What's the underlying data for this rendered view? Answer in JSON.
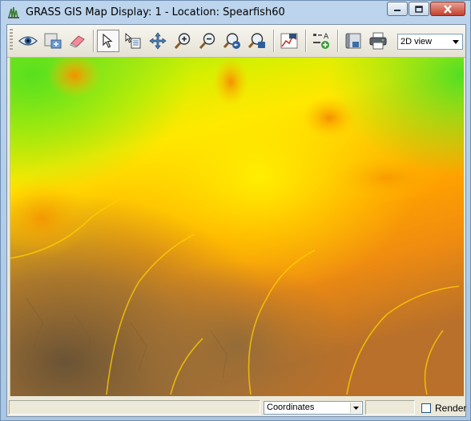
{
  "window": {
    "title": "GRASS GIS Map Display: 1 - Location: Spearfish60",
    "controls": {
      "minimize": "minimize",
      "maximize": "maximize",
      "close": "close"
    }
  },
  "toolbar": {
    "tools": [
      {
        "id": "display-map",
        "icon": "eye-icon",
        "tooltip": ""
      },
      {
        "id": "render-map",
        "icon": "render-map-icon",
        "tooltip": ""
      },
      {
        "id": "erase",
        "icon": "eraser-icon",
        "tooltip": ""
      },
      {
        "id": "pointer",
        "icon": "pointer-icon",
        "active": true
      },
      {
        "id": "query",
        "icon": "query-icon"
      },
      {
        "id": "pan",
        "icon": "pan-icon"
      },
      {
        "id": "zoom-in",
        "icon": "zoom-in-icon"
      },
      {
        "id": "zoom-out",
        "icon": "zoom-out-icon"
      },
      {
        "id": "zoom-back",
        "icon": "zoom-back-icon"
      },
      {
        "id": "zoom-menu",
        "icon": "zoom-menu-icon"
      },
      {
        "id": "analyze",
        "icon": "analyze-icon"
      },
      {
        "id": "overlay",
        "icon": "overlay-icon"
      },
      {
        "id": "save",
        "icon": "save-icon"
      },
      {
        "id": "print",
        "icon": "print-icon"
      }
    ],
    "view_mode": {
      "selected": "2D view",
      "options": [
        "2D view"
      ]
    }
  },
  "map": {
    "description_colors": {
      "low": "#6a5335",
      "mid_low": "#f08c0a",
      "mid": "#ffa500",
      "mid_high": "#ffe000",
      "high": "#62e81c"
    }
  },
  "statusbar": {
    "mode": {
      "selected": "Coordinates"
    },
    "render_label": "Render",
    "render_checked": false
  }
}
